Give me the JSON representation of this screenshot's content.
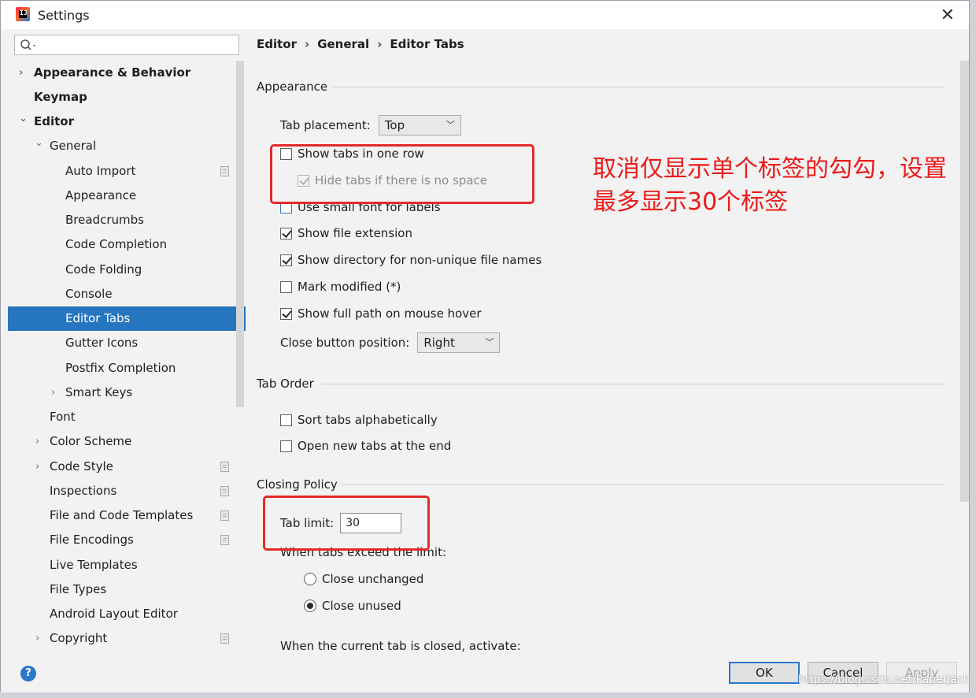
{
  "window": {
    "title": "Settings"
  },
  "search": {
    "placeholder": ""
  },
  "tree": [
    {
      "label": "Appearance & Behavior",
      "arrow": "›"
    },
    {
      "label": "Keymap",
      "arrow": ""
    },
    {
      "label": "Editor",
      "arrow": "⌄"
    },
    {
      "label": "General",
      "arrow": "⌄"
    },
    {
      "label": "Auto Import",
      "arrow": ""
    },
    {
      "label": "Appearance",
      "arrow": ""
    },
    {
      "label": "Breadcrumbs",
      "arrow": ""
    },
    {
      "label": "Code Completion",
      "arrow": ""
    },
    {
      "label": "Code Folding",
      "arrow": ""
    },
    {
      "label": "Console",
      "arrow": ""
    },
    {
      "label": "Editor Tabs",
      "arrow": ""
    },
    {
      "label": "Gutter Icons",
      "arrow": ""
    },
    {
      "label": "Postfix Completion",
      "arrow": ""
    },
    {
      "label": "Smart Keys",
      "arrow": "›"
    },
    {
      "label": "Font",
      "arrow": ""
    },
    {
      "label": "Color Scheme",
      "arrow": "›"
    },
    {
      "label": "Code Style",
      "arrow": "›"
    },
    {
      "label": "Inspections",
      "arrow": ""
    },
    {
      "label": "File and Code Templates",
      "arrow": ""
    },
    {
      "label": "File Encodings",
      "arrow": ""
    },
    {
      "label": "Live Templates",
      "arrow": ""
    },
    {
      "label": "File Types",
      "arrow": ""
    },
    {
      "label": "Android Layout Editor",
      "arrow": ""
    },
    {
      "label": "Copyright",
      "arrow": "›"
    }
  ],
  "breadcrumb": [
    "Editor",
    "General",
    "Editor Tabs"
  ],
  "breadcrumb_sep": "›",
  "appearance": {
    "title": "Appearance",
    "tab_placement_label": "Tab placement:",
    "tab_placement_value": "Top",
    "show_tabs_one_row": "Show tabs in one row",
    "hide_tabs_no_space": "Hide tabs if there is no space",
    "small_font": "Use small font for labels",
    "show_ext": "Show file extension",
    "show_dir": "Show directory for non-unique file names",
    "mark_modified": "Mark modified (*)",
    "full_path": "Show full path on mouse hover",
    "close_btn_label": "Close button position:",
    "close_btn_value": "Right"
  },
  "tab_order": {
    "title": "Tab Order",
    "sort": "Sort tabs alphabetically",
    "open_end": "Open new tabs at the end"
  },
  "closing": {
    "title": "Closing Policy",
    "tab_limit_label": "Tab limit:",
    "tab_limit_value": "30",
    "exceed_label": "When tabs exceed the limit:",
    "close_unchanged": "Close unchanged",
    "close_unused": "Close unused",
    "activate_label": "When the current tab is closed, activate:"
  },
  "annotation": {
    "text": "取消仅显示单个标签的勾勾，设置最多显示30个标签",
    "color": "#ea1b1b"
  },
  "buttons": {
    "ok": "OK",
    "cancel": "Cancel",
    "apply": "Apply",
    "help": "?"
  },
  "watermark": "https://blog.csdn.net/PaperJack",
  "colors": {
    "selection": "#2675bf",
    "accent": "#2b78c8"
  }
}
